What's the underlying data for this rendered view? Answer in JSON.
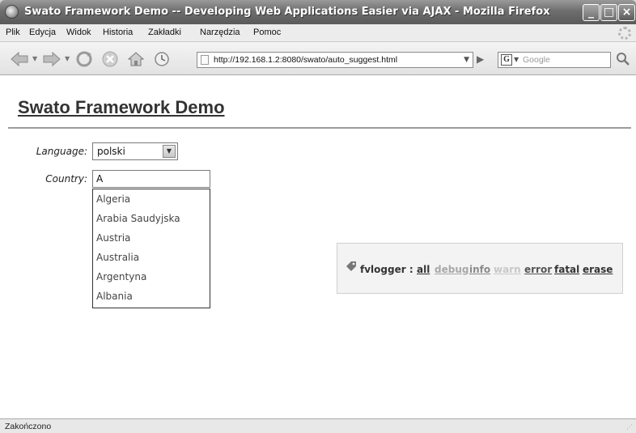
{
  "window": {
    "title": "Swato Framework Demo -- Developing Web Applications Easier via AJAX - Mozilla Firefox",
    "controls": {
      "minimize": "_",
      "maximize": "□",
      "close": "×"
    }
  },
  "menu": {
    "items": [
      "Plik",
      "Edycja",
      "Widok",
      "Historia",
      "Zakładki",
      "Narzędzia",
      "Pomoc"
    ]
  },
  "navbar": {
    "url": "http://192.168.1.2:8080/swato/auto_suggest.html",
    "search_engine": "G",
    "search_placeholder": "Google",
    "icons": [
      "back-icon",
      "forward-icon",
      "reload-icon",
      "stop-icon",
      "home-icon",
      "history-icon",
      "page-icon",
      "go-icon",
      "search-icon"
    ]
  },
  "page": {
    "title": "Swato Framework Demo",
    "language_label": "Language:",
    "language_value": "polski",
    "country_label": "Country:",
    "country_value": "A",
    "suggestions": [
      "Algeria",
      "Arabia Saudyjska",
      "Austria",
      "Australia",
      "Argentyna",
      "Albania"
    ]
  },
  "fvlogger": {
    "label": "fvlogger :",
    "links": [
      {
        "text": "all",
        "color": "#333333"
      },
      {
        "text": "debug",
        "color": "#a8a8a8"
      },
      {
        "text": "info",
        "color": "#8a8a8a"
      },
      {
        "text": "warn",
        "color": "#c8c8c8"
      },
      {
        "text": "error",
        "color": "#555555"
      },
      {
        "text": "fatal",
        "color": "#333333"
      },
      {
        "text": "erase",
        "color": "#333333"
      }
    ]
  },
  "status": {
    "text": "Zakończono"
  }
}
